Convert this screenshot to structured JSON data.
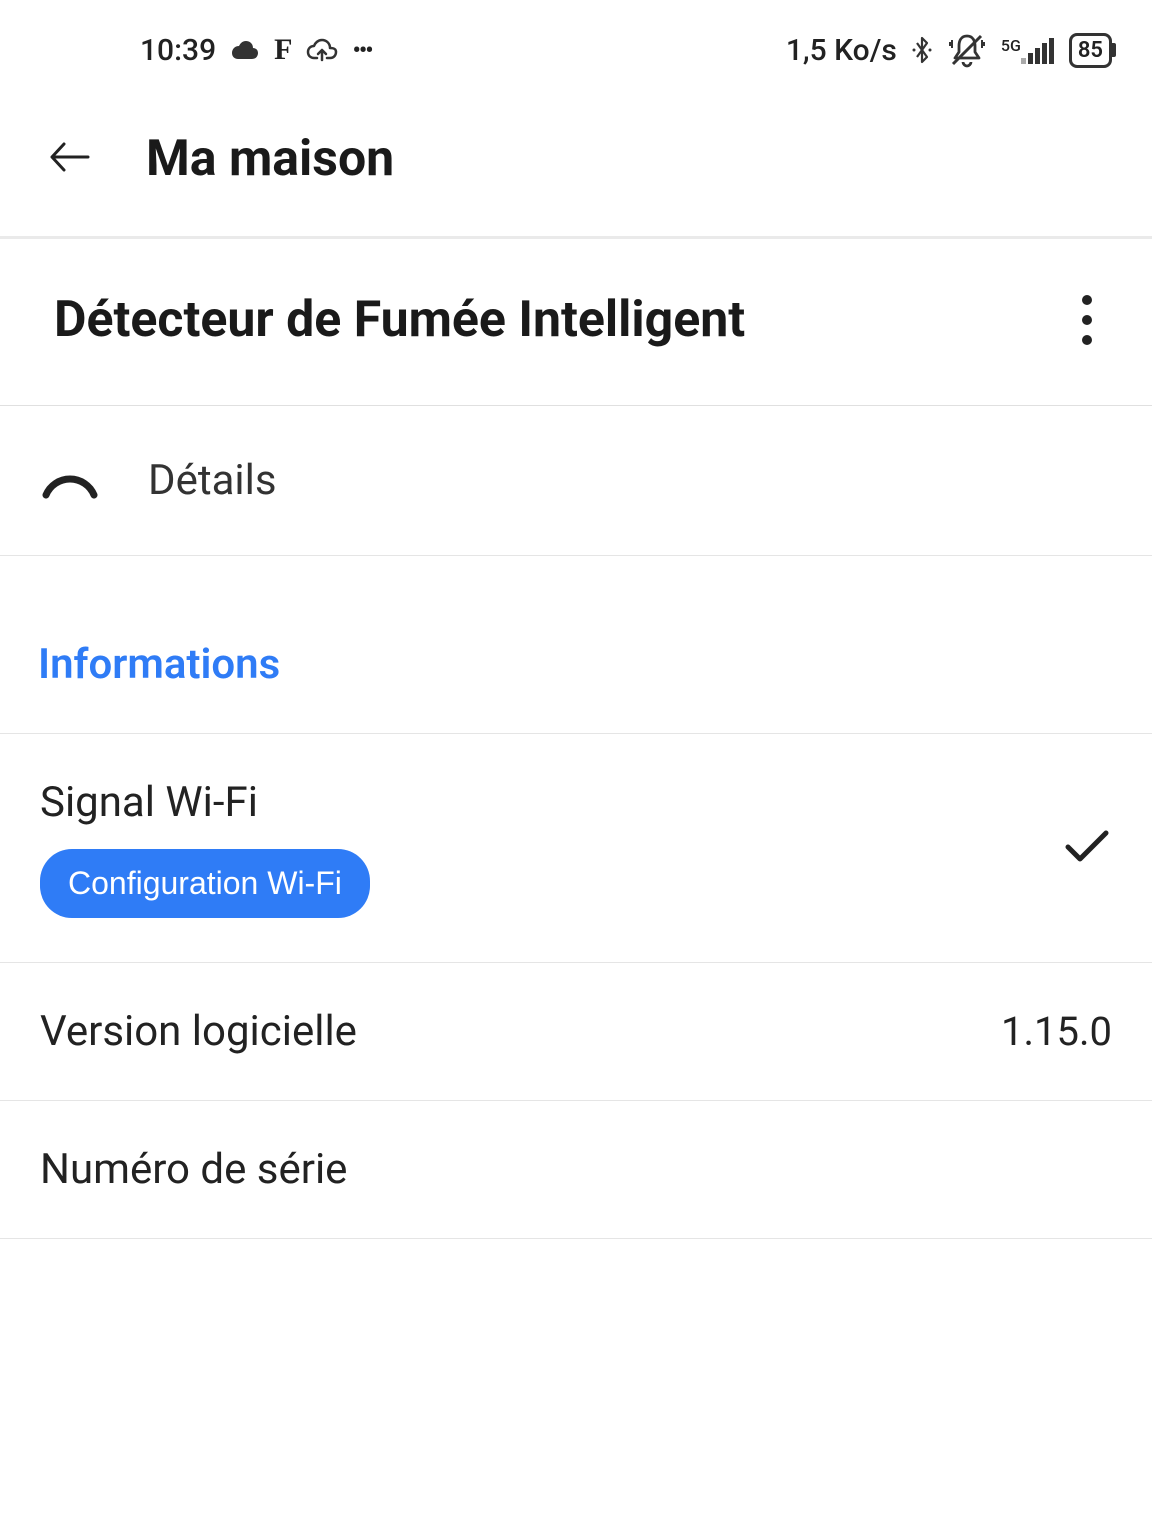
{
  "statusbar": {
    "time": "10:39",
    "data_rate": "1,5 Ko/s",
    "network_label": "5G",
    "battery_percent": "85"
  },
  "header": {
    "title": "Ma maison"
  },
  "device": {
    "name": "Détecteur de Fumée Intelligent"
  },
  "details": {
    "label": "Détails"
  },
  "sections": {
    "informations": {
      "title": "Informations",
      "wifi": {
        "label": "Signal Wi-Fi",
        "config_button": "Configuration Wi-Fi"
      },
      "software": {
        "label": "Version logicielle",
        "value": "1.15.0"
      },
      "serial": {
        "label": "Numéro de série"
      }
    }
  }
}
